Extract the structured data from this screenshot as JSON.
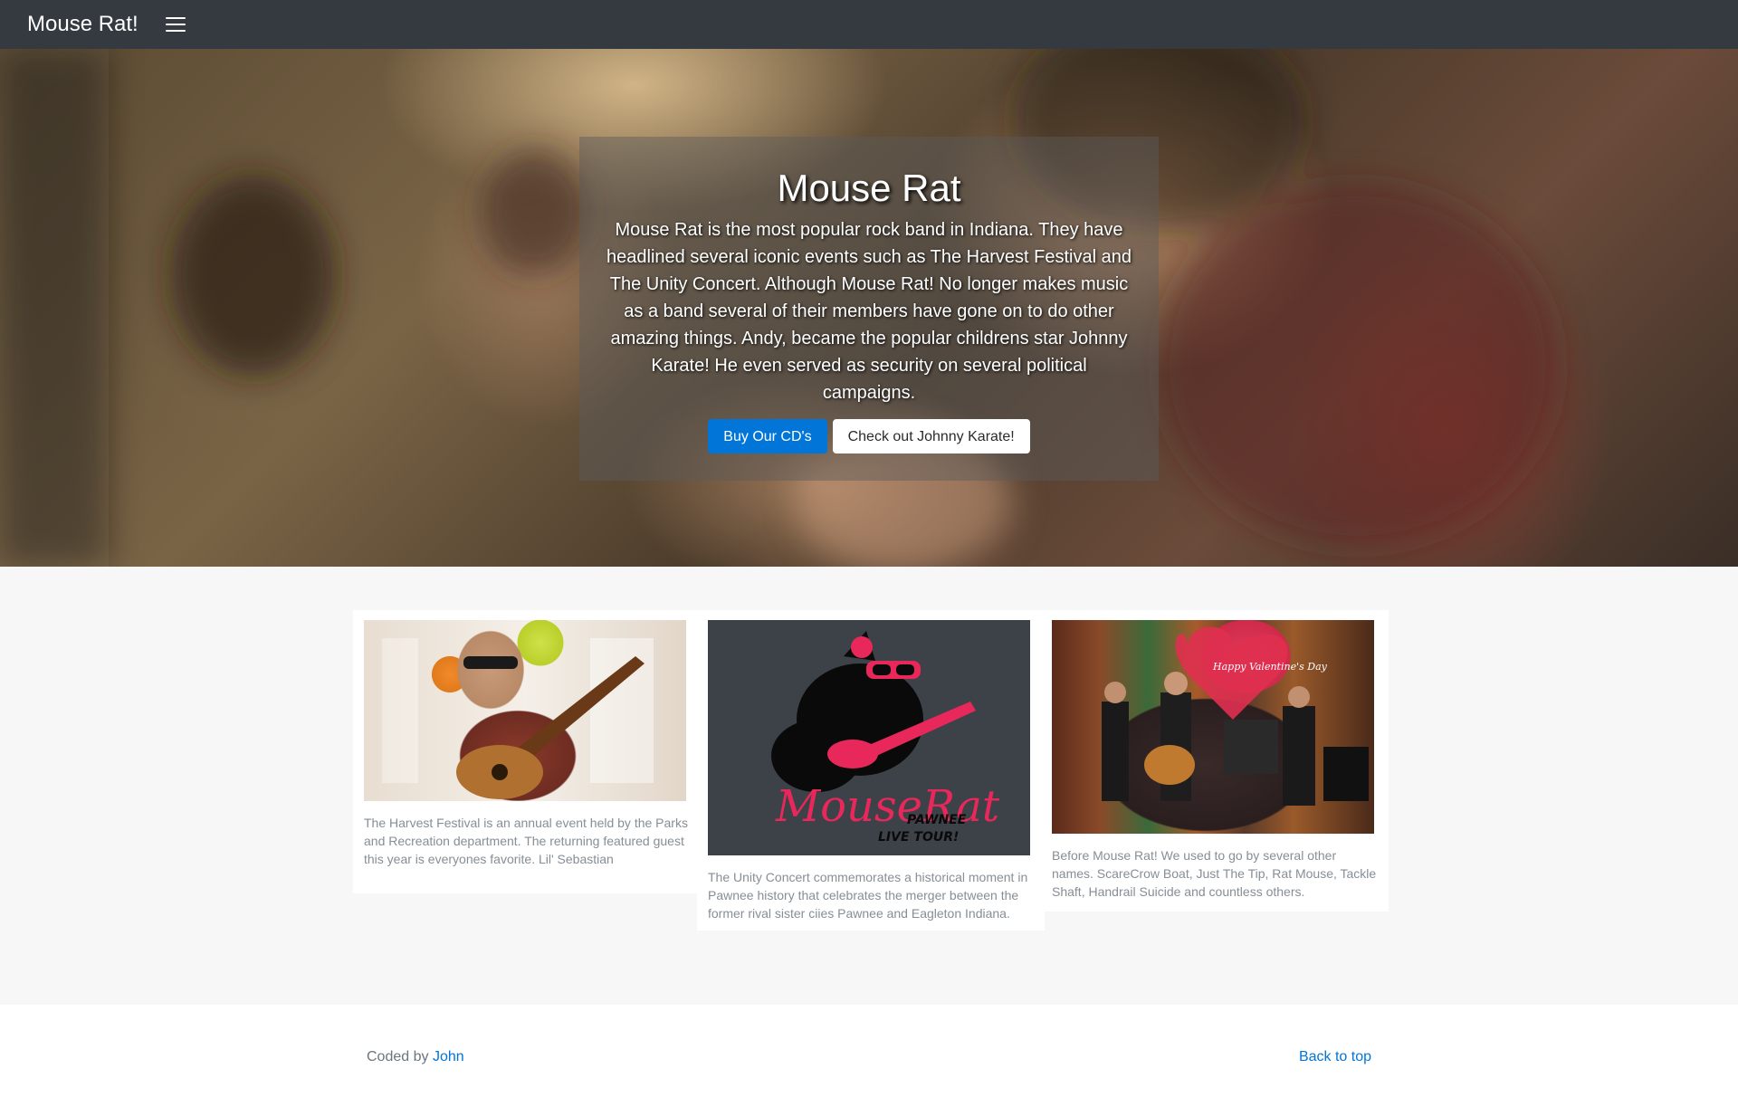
{
  "navbar": {
    "brand": "Mouse Rat!",
    "menu_icon": "hamburger-menu-icon"
  },
  "hero": {
    "title": "Mouse Rat",
    "text": "Mouse Rat is the most popular rock band in Indiana. They have headlined several iconic events such as The Harvest Festival and The Unity Concert. Although Mouse Rat! No longer makes music as a band several of their members have gone on to do other amazing things. Andy, became the popular childrens star Johnny Karate! He even served as security on several political campaigns.",
    "primary_button": "Buy Our CD's",
    "secondary_button": "Check out Johnny Karate!"
  },
  "cards": [
    {
      "image": "guitarist-photo",
      "text": "The Harvest Festival is an annual event held by the Parks and Recreation department. The returning featured guest this year is everyones favorite. Lil' Sebastian"
    },
    {
      "image": "mouse-rat-logo",
      "logo_text": "MouseRat",
      "logo_sub1": "PAWNEE",
      "logo_sub2": "LIVE TOUR!",
      "text": "The Unity Concert commemorates a historical moment in Pawnee history that celebrates the merger between the former rival sister ciies Pawnee and Eagleton Indiana."
    },
    {
      "image": "band-stage-photo",
      "sign_text": "Happy Valentine's Day",
      "text": "Before Mouse Rat! We used to go by several other names. ScareCrow Boat, Just The Tip, Rat Mouse, Tackle Shaft, Handrail Suicide and countless others."
    }
  ],
  "footer": {
    "coded_by": "Coded by",
    "author": "John",
    "back_to_top": "Back to top"
  },
  "colors": {
    "navbar": "#343a40",
    "primary": "#0275d8",
    "section_bg": "#f7f7f7",
    "muted_text": "#868e96"
  }
}
